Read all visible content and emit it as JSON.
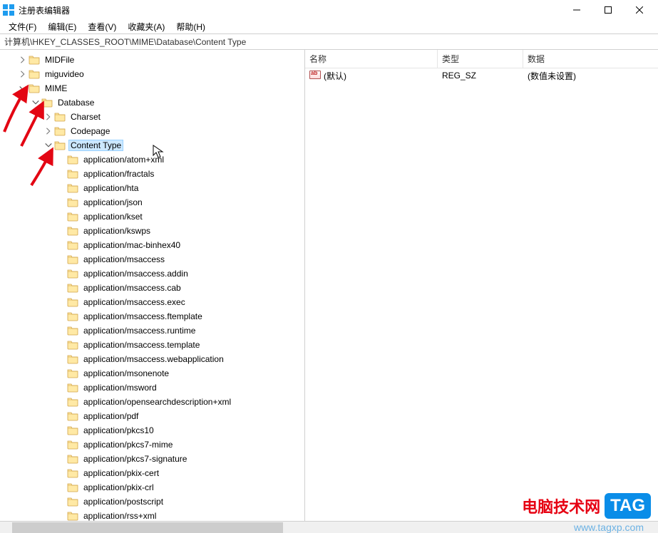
{
  "window": {
    "title": "注册表编辑器"
  },
  "menu": {
    "file": "文件(F)",
    "edit": "编辑(E)",
    "view": "查看(V)",
    "fav": "收藏夹(A)",
    "help": "帮助(H)"
  },
  "address": {
    "path": "计算机\\HKEY_CLASSES_ROOT\\MIME\\Database\\Content Type"
  },
  "columns": {
    "name": "名称",
    "type": "类型",
    "data": "数据"
  },
  "values": [
    {
      "name": "(默认)",
      "type": "REG_SZ",
      "data": "(数值未设置)"
    }
  ],
  "tree": {
    "top": [
      "MIDFile",
      "miguvideo"
    ],
    "mime": "MIME",
    "database": "Database",
    "charset": "Charset",
    "codepage": "Codepage",
    "content_type": "Content Type",
    "children": [
      "application/atom+xml",
      "application/fractals",
      "application/hta",
      "application/json",
      "application/kset",
      "application/kswps",
      "application/mac-binhex40",
      "application/msaccess",
      "application/msaccess.addin",
      "application/msaccess.cab",
      "application/msaccess.exec",
      "application/msaccess.ftemplate",
      "application/msaccess.runtime",
      "application/msaccess.template",
      "application/msaccess.webapplication",
      "application/msonenote",
      "application/msword",
      "application/opensearchdescription+xml",
      "application/pdf",
      "application/pkcs10",
      "application/pkcs7-mime",
      "application/pkcs7-signature",
      "application/pkix-cert",
      "application/pkix-crl",
      "application/postscript",
      "application/rss+xml"
    ]
  },
  "watermark": {
    "text1": "电脑技术网",
    "tag": "TAG",
    "url": "www.tagxp.com"
  }
}
